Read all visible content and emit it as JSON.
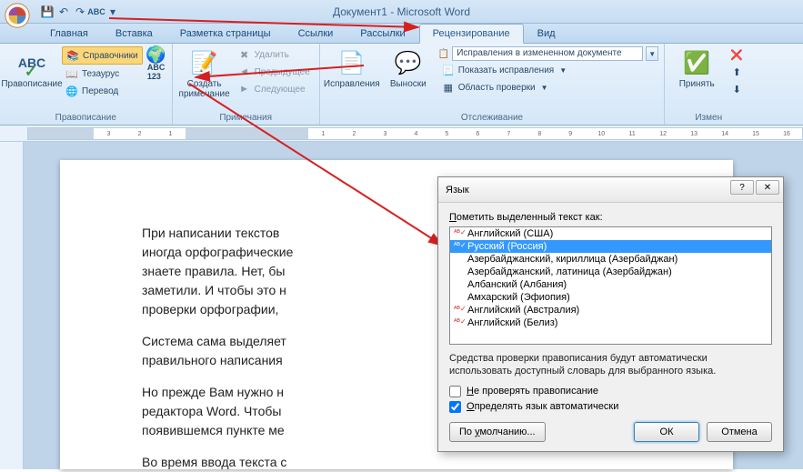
{
  "title": "Документ1 - Microsoft Word",
  "tabs": [
    "Главная",
    "Вставка",
    "Разметка страницы",
    "Ссылки",
    "Рассылки",
    "Рецензирование",
    "Вид"
  ],
  "activeTab": 5,
  "ribbon": {
    "proofing": {
      "label": "Правописание",
      "spelling": "Правописание",
      "research": "Справочники",
      "thesaurus": "Тезаурус",
      "translate": "Перевод",
      "langIcon": "ABC"
    },
    "comments": {
      "label": "Примечания",
      "new": "Создать примечание",
      "delete": "Удалить",
      "prev": "Предыдущее",
      "next": "Следующее"
    },
    "tracking": {
      "label": "Отслеживание",
      "track": "Исправления",
      "balloons": "Выноски",
      "display": "Исправления в измененном документе",
      "show": "Показать исправления",
      "panel": "Область проверки"
    },
    "changes": {
      "label": "Измен",
      "accept": "Принять"
    }
  },
  "doc": {
    "p1": "При написании текстов",
    "p1b": " иногда орфографические",
    "p1c": "знаете правила. Нет, бы",
    "p1d": "заметили. И чтобы это н",
    "p1e": "проверки орфографии,",
    "p2": "Система сама выделяет",
    "p2b": "правильного написания",
    "p3": "Но прежде Вам нужно н",
    "p3b": "редактора Word. Чтобы",
    "p3c": "появившемся пункте ме",
    "p4": "Во время ввода текста с"
  },
  "dialog": {
    "title": "Язык",
    "label_prefix": "П",
    "label_rest": "ометить выделенный текст как:",
    "languages": [
      {
        "name": "Английский (США)",
        "checked": true
      },
      {
        "name": "Русский (Россия)",
        "checked": true,
        "selected": true
      },
      {
        "name": "Азербайджанский, кириллица (Азербайджан)",
        "checked": false
      },
      {
        "name": "Азербайджанский, латиница (Азербайджан)",
        "checked": false
      },
      {
        "name": "Албанский (Албания)",
        "checked": false
      },
      {
        "name": "Амхарский (Эфиопия)",
        "checked": false
      },
      {
        "name": "Английский (Австралия)",
        "checked": true
      },
      {
        "name": "Английский (Белиз)",
        "checked": true
      }
    ],
    "note": "Средства проверки правописания будут автоматически использовать доступный словарь для выбранного языка.",
    "check1_u": "Н",
    "check1_rest": "е проверять правописание",
    "check2_u": "О",
    "check2_rest": "пределять язык автоматически",
    "default_btn_u": "у",
    "default_btn_pre": "По ",
    "default_btn_post": "молчанию...",
    "ok": "ОК",
    "cancel": "Отмена"
  }
}
